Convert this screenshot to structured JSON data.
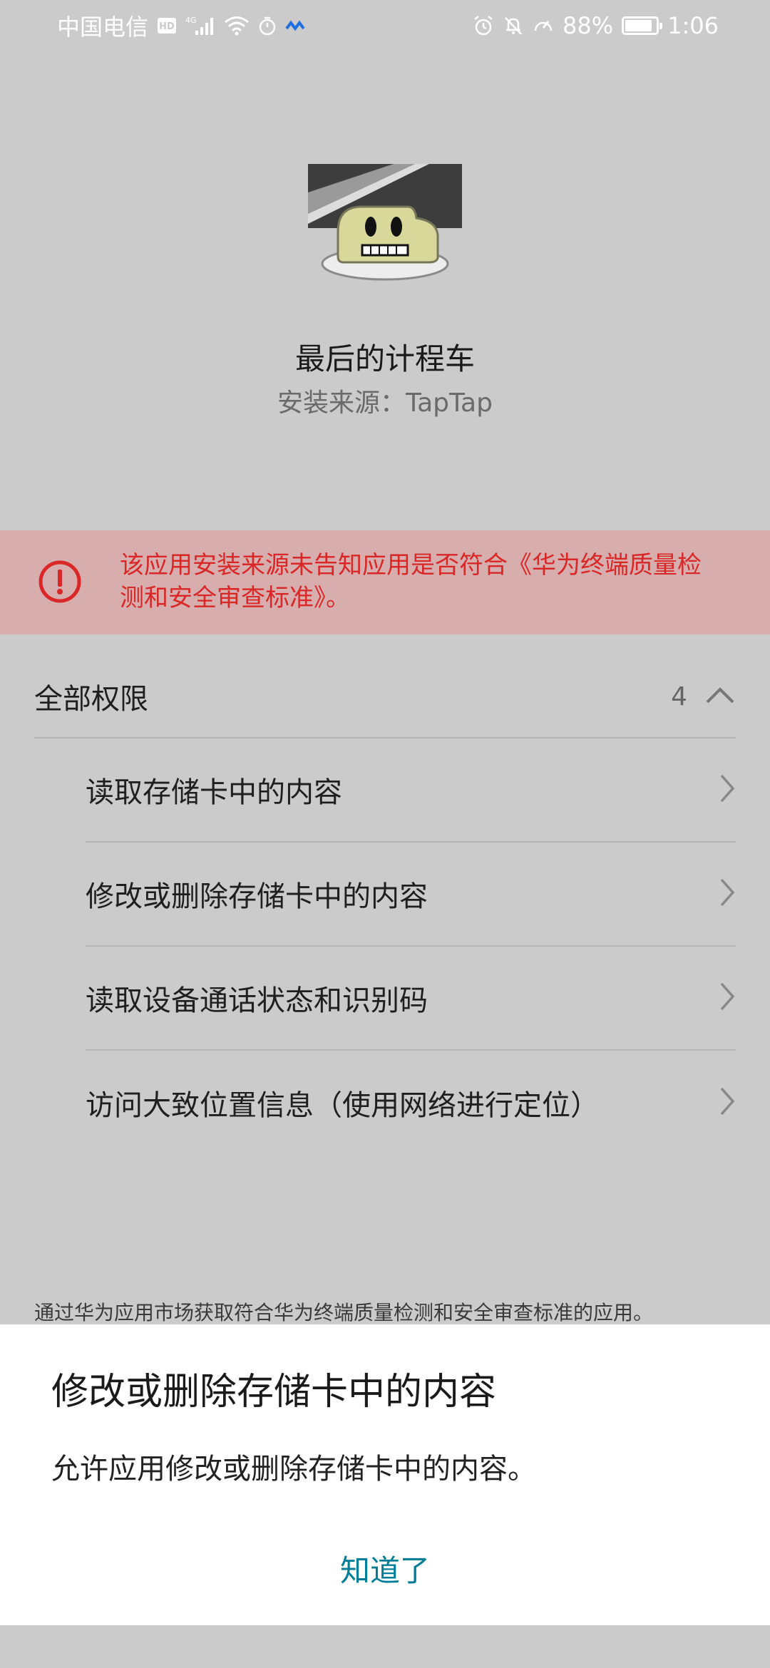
{
  "status_bar": {
    "carrier": "中国电信",
    "hd": "HD",
    "network": "4G",
    "battery": "88%",
    "battery_level": 0.88,
    "time": "1:06"
  },
  "app": {
    "name": "最后的计程车",
    "install_source": "安装来源：TapTap"
  },
  "warning": {
    "text": "该应用安装来源未告知应用是否符合《华为终端质量检测和安全审查标准》。",
    "color": "#d92626"
  },
  "permissions": {
    "title": "全部权限",
    "count": "4",
    "items": [
      {
        "label": "读取存储卡中的内容"
      },
      {
        "label": "修改或删除存储卡中的内容"
      },
      {
        "label": "读取设备通话状态和识别码"
      },
      {
        "label": "访问大致位置信息（使用网络进行定位）"
      }
    ]
  },
  "footer_note": "通过华为应用市场获取符合华为终端质量检测和安全审查标准的应用。",
  "dialog": {
    "title": "修改或删除存储卡中的内容",
    "body": "允许应用修改或删除存储卡中的内容。",
    "button": "知道了",
    "button_color": "#007d99"
  }
}
